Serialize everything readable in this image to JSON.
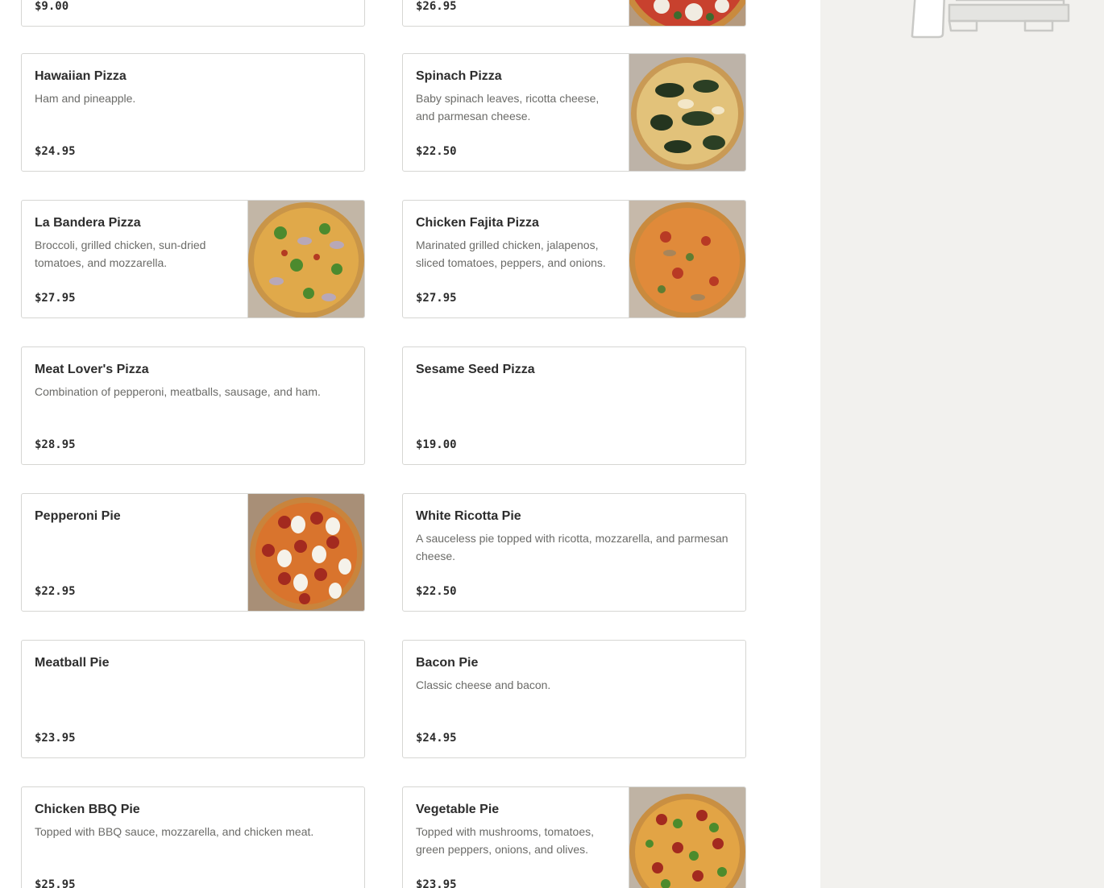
{
  "menu": {
    "items": [
      {
        "name": "",
        "description": "",
        "price": "$9.00"
      },
      {
        "name": "",
        "description": "",
        "price": "$26.95",
        "image": "margherita-pizza-photo"
      },
      {
        "name": "Hawaiian Pizza",
        "description": "Ham and pineapple.",
        "price": "$24.95"
      },
      {
        "name": "Spinach Pizza",
        "description": "Baby spinach leaves, ricotta cheese, and parmesan cheese.",
        "price": "$22.50",
        "image": "spinach-pizza-photo"
      },
      {
        "name": "La Bandera Pizza",
        "description": "Broccoli, grilled chicken, sun-dried tomatoes, and mozzarella.",
        "price": "$27.95",
        "image": "la-bandera-pizza-photo"
      },
      {
        "name": "Chicken Fajita Pizza",
        "description": "Marinated grilled chicken, jalapenos, sliced tomatoes, peppers, and onions.",
        "price": "$27.95",
        "image": "chicken-fajita-pizza-photo"
      },
      {
        "name": "Meat Lover's Pizza",
        "description": "Combination of pepperoni, meatballs, sausage, and ham.",
        "price": "$28.95"
      },
      {
        "name": "Sesame Seed Pizza",
        "description": "",
        "price": "$19.00"
      },
      {
        "name": "Pepperoni Pie",
        "description": "",
        "price": "$22.95",
        "image": "pepperoni-pie-photo"
      },
      {
        "name": "White Ricotta Pie",
        "description": "A sauceless pie topped with ricotta, mozzarella, and parmesan cheese.",
        "price": "$22.50"
      },
      {
        "name": "Meatball Pie",
        "description": "",
        "price": "$23.95"
      },
      {
        "name": "Bacon Pie",
        "description": "Classic cheese and bacon.",
        "price": "$24.95"
      },
      {
        "name": "Chicken BBQ Pie",
        "description": "Topped with BBQ sauce, mozzarella, and chicken meat.",
        "price": "$25.95"
      },
      {
        "name": "Vegetable Pie",
        "description": "Topped with mushrooms, tomatoes, green peppers, onions, and olives.",
        "price": "$23.95",
        "image": "vegetable-pie-photo"
      }
    ]
  },
  "sidebar": {
    "illustration": "empty-bag-illustration"
  },
  "colors": {
    "border": "#d6d6d3",
    "text": "#2d2d2d",
    "muted": "#6b6b68",
    "sidebar_bg": "#f2f1ee"
  }
}
